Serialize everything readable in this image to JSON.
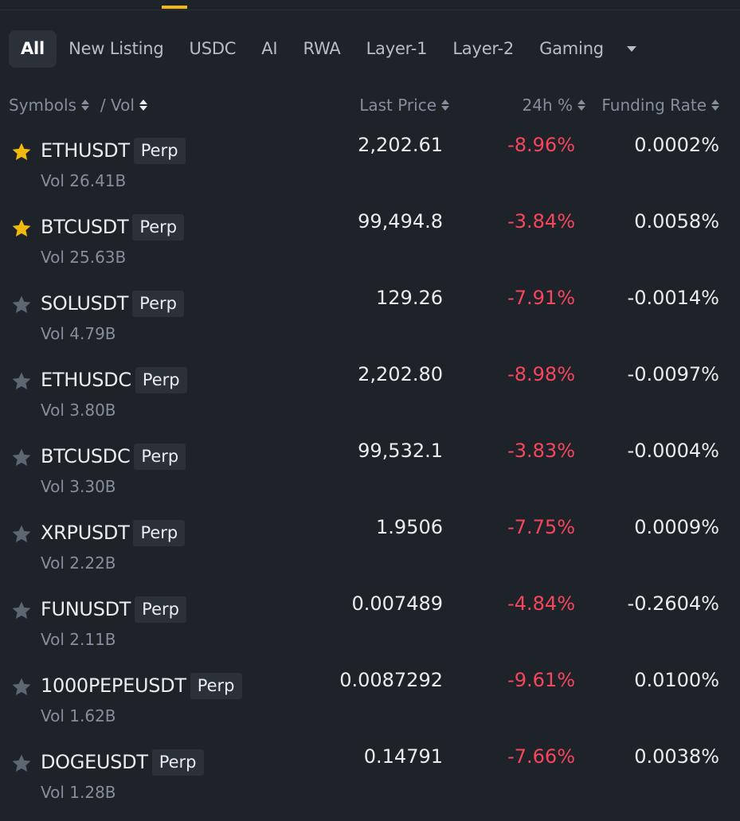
{
  "colors": {
    "background": "#1e2329",
    "tab_active_bg": "#2b3139",
    "accent_yellow": "#f0b90b",
    "negative": "#f6465d",
    "muted": "#848e9c",
    "star_inactive": "#5e6673"
  },
  "tabs": [
    {
      "label": "All",
      "active": true
    },
    {
      "label": "New Listing",
      "active": false
    },
    {
      "label": "USDC",
      "active": false
    },
    {
      "label": "AI",
      "active": false
    },
    {
      "label": "RWA",
      "active": false
    },
    {
      "label": "Layer-1",
      "active": false
    },
    {
      "label": "Layer-2",
      "active": false
    },
    {
      "label": "Gaming",
      "active": false
    }
  ],
  "tabs_more_icon": "caret-down-icon",
  "header": {
    "symbols": "Symbols",
    "vol": "/ Vol",
    "last_price": "Last Price",
    "change_24h": "24h %",
    "funding_rate": "Funding Rate"
  },
  "rows": [
    {
      "symbol": "ETHUSDT",
      "tag": "Perp",
      "vol": "Vol 26.41B",
      "price": "2,202.61",
      "change": "-8.96%",
      "funding": "0.0002%",
      "favorite": true
    },
    {
      "symbol": "BTCUSDT",
      "tag": "Perp",
      "vol": "Vol 25.63B",
      "price": "99,494.8",
      "change": "-3.84%",
      "funding": "0.0058%",
      "favorite": true
    },
    {
      "symbol": "SOLUSDT",
      "tag": "Perp",
      "vol": "Vol 4.79B",
      "price": "129.26",
      "change": "-7.91%",
      "funding": "-0.0014%",
      "favorite": false
    },
    {
      "symbol": "ETHUSDC",
      "tag": "Perp",
      "vol": "Vol 3.80B",
      "price": "2,202.80",
      "change": "-8.98%",
      "funding": "-0.0097%",
      "favorite": false
    },
    {
      "symbol": "BTCUSDC",
      "tag": "Perp",
      "vol": "Vol 3.30B",
      "price": "99,532.1",
      "change": "-3.83%",
      "funding": "-0.0004%",
      "favorite": false
    },
    {
      "symbol": "XRPUSDT",
      "tag": "Perp",
      "vol": "Vol 2.22B",
      "price": "1.9506",
      "change": "-7.75%",
      "funding": "0.0009%",
      "favorite": false
    },
    {
      "symbol": "FUNUSDT",
      "tag": "Perp",
      "vol": "Vol 2.11B",
      "price": "0.007489",
      "change": "-4.84%",
      "funding": "-0.2604%",
      "favorite": false
    },
    {
      "symbol": "1000PEPEUSDT",
      "tag": "Perp",
      "vol": "Vol 1.62B",
      "price": "0.0087292",
      "change": "-9.61%",
      "funding": "0.0100%",
      "favorite": false
    },
    {
      "symbol": "DOGEUSDT",
      "tag": "Perp",
      "vol": "Vol 1.28B",
      "price": "0.14791",
      "change": "-7.66%",
      "funding": "0.0038%",
      "favorite": false
    }
  ]
}
